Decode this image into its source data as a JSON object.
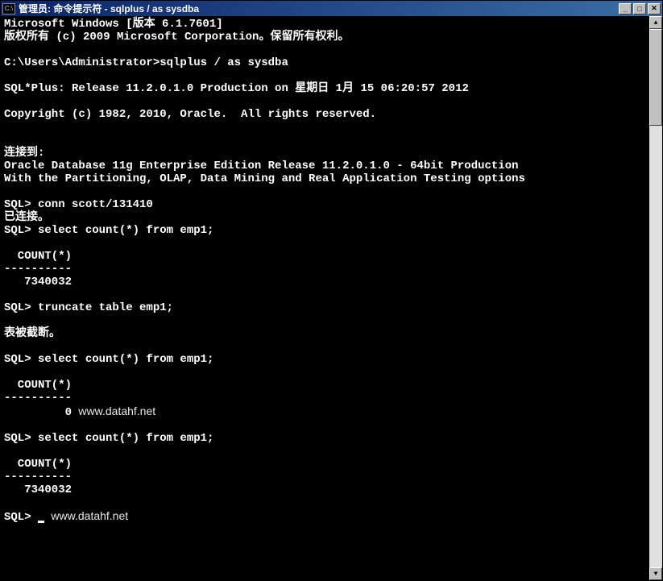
{
  "titlebar": {
    "icon_text": "C:\\",
    "title": "管理员: 命令提示符 - sqlplus  / as sysdba"
  },
  "terminal": {
    "lines": [
      "Microsoft Windows [版本 6.1.7601]",
      "版权所有 (c) 2009 Microsoft Corporation。保留所有权利。",
      "",
      "C:\\Users\\Administrator>sqlplus / as sysdba",
      "",
      "SQL*Plus: Release 11.2.0.1.0 Production on 星期日 1月 15 06:20:57 2012",
      "",
      "Copyright (c) 1982, 2010, Oracle.  All rights reserved.",
      "",
      "",
      "连接到:",
      "Oracle Database 11g Enterprise Edition Release 11.2.0.1.0 - 64bit Production",
      "With the Partitioning, OLAP, Data Mining and Real Application Testing options",
      "",
      "SQL> conn scott/131410",
      "已连接。",
      "SQL> select count(*) from emp1;",
      "",
      "  COUNT(*)",
      "----------",
      "   7340032",
      "",
      "SQL> truncate table emp1;",
      "",
      "表被截断。",
      "",
      "SQL> select count(*) from emp1;",
      "",
      "  COUNT(*)",
      "----------",
      "         0",
      "",
      "SQL> select count(*) from emp1;",
      "",
      "  COUNT(*)",
      "----------",
      "   7340032",
      "",
      "SQL> "
    ],
    "watermark": "www.datahf.net",
    "watermark_line_indices": [
      30,
      38
    ]
  }
}
